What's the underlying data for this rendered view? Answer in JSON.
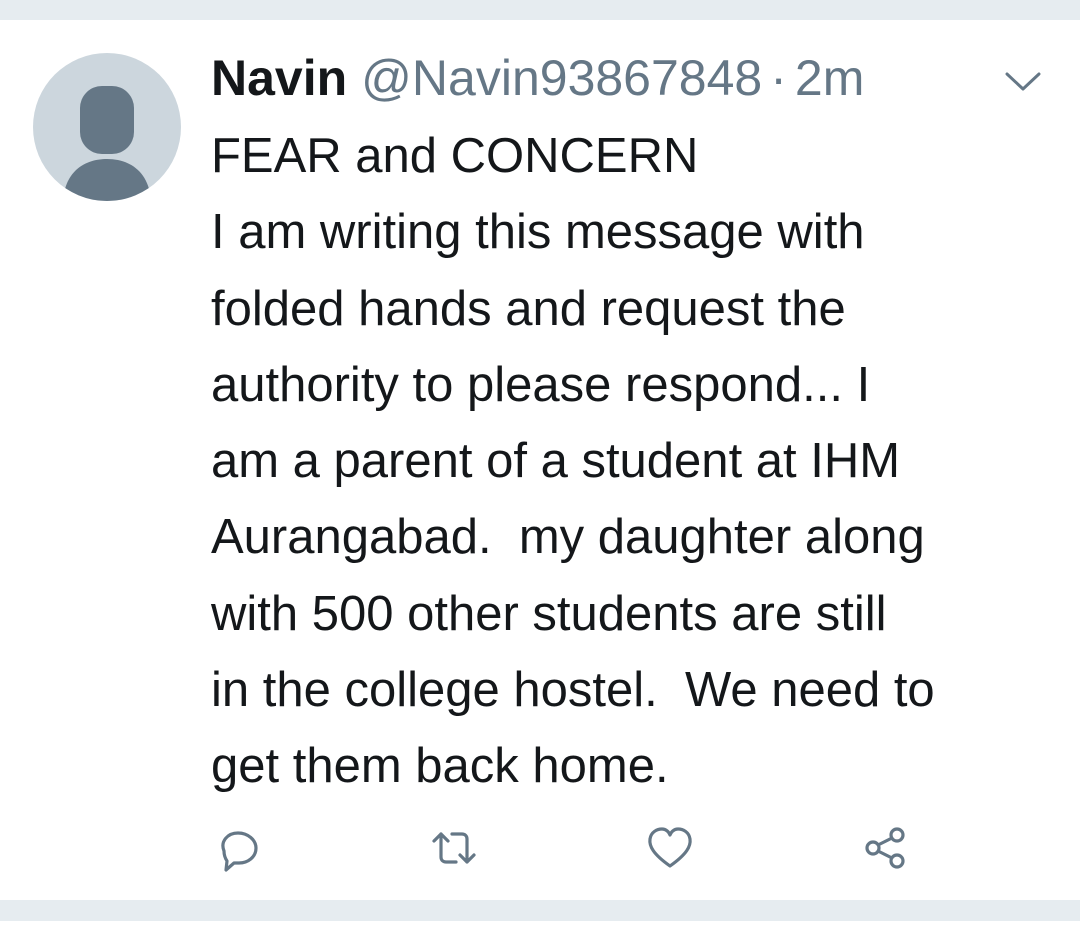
{
  "tweet": {
    "author": {
      "display_name": "Navin",
      "handle": "@Navin93867848"
    },
    "separator": "·",
    "time_ago": "2m",
    "text_lines": [
      "FEAR and CONCERN",
      "I am writing this message with",
      "folded hands and request the",
      "authority to please respond... I",
      "am a parent of a student at IHM",
      "Aurangabad.  my daughter along",
      "with 500 other students are still",
      "in the college hostel.  We need to",
      "get them back home."
    ]
  },
  "icons": {
    "avatar": "default-user-avatar",
    "menu": "chevron-down-icon",
    "reply": "reply-icon",
    "retweet": "retweet-icon",
    "like": "heart-icon",
    "share": "share-icon"
  },
  "colors": {
    "text_primary": "#14171a",
    "text_secondary": "#657786",
    "icon_gray": "#657786",
    "avatar_bg": "#ccd6dd",
    "avatar_silhouette": "#657786",
    "separator_bar": "#e6ecf0"
  }
}
